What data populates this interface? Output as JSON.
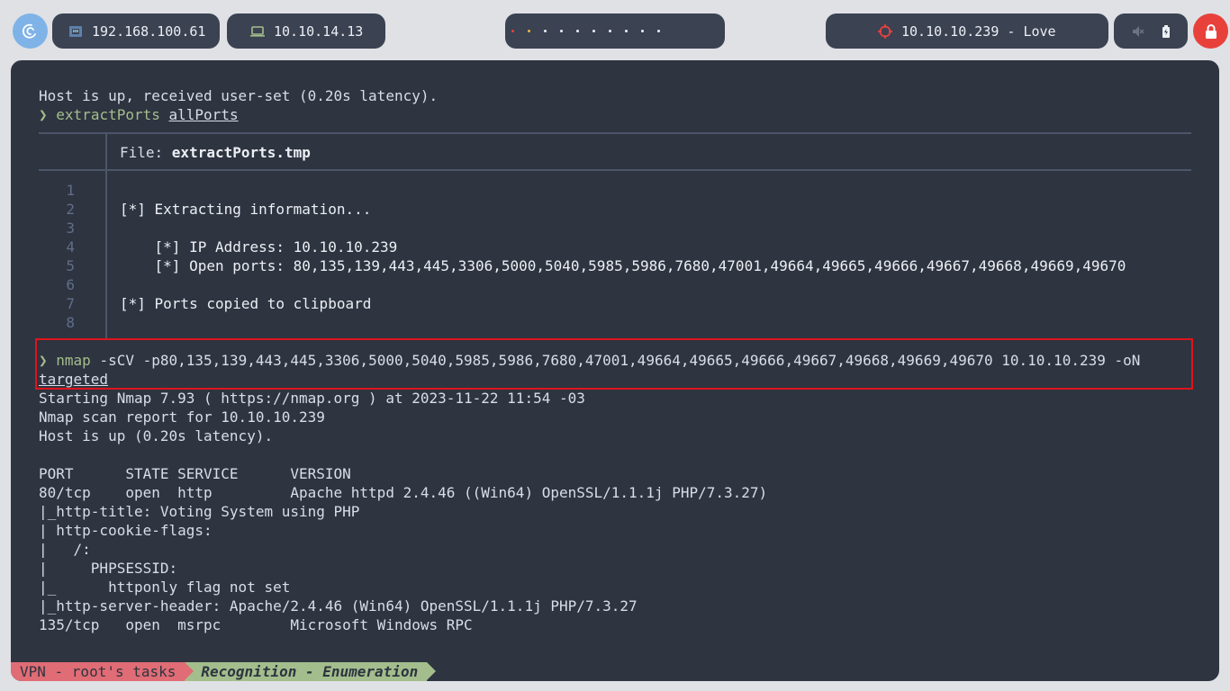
{
  "topbar": {
    "vpn_ip": "192.168.100.61",
    "tun_ip": "10.10.14.13",
    "target": "10.10.10.239 - Love",
    "workspace_dot_colors": [
      "#e8413c",
      "#e8b93c",
      "#eceff4",
      "#eceff4",
      "#eceff4",
      "#eceff4",
      "#eceff4",
      "#eceff4",
      "#eceff4",
      "#eceff4"
    ],
    "icons": [
      "debian-swirl-icon",
      "ethernet-icon",
      "laptop-icon",
      "target-icon",
      "mute-icon",
      "battery-icon",
      "lock-icon"
    ]
  },
  "terminal": {
    "line_host_up": "Host is up, received user-set (0.20s latency).",
    "prompt_symbol": "❯",
    "cmd1_name": "extractPorts",
    "cmd1_arg": "allPorts",
    "file_label": "File: ",
    "file_name": "extractPorts.tmp",
    "file_lines": [
      {
        "n": "1",
        "text": ""
      },
      {
        "n": "2",
        "text": "[*] Extracting information..."
      },
      {
        "n": "3",
        "text": ""
      },
      {
        "n": "4",
        "text": "    [*] IP Address: 10.10.10.239"
      },
      {
        "n": "5",
        "text": "    [*] Open ports: 80,135,139,443,445,3306,5000,5040,5985,5986,7680,47001,49664,49665,49666,49667,49668,49669,49670"
      },
      {
        "n": "6",
        "text": ""
      },
      {
        "n": "7",
        "text": "[*] Ports copied to clipboard"
      },
      {
        "n": "8",
        "text": ""
      }
    ],
    "cmd2_name": "nmap",
    "cmd2_args": " -sCV -p80,135,139,443,445,3306,5000,5040,5985,5986,7680,47001,49664,49665,49666,49667,49668,49669,49670 10.10.10.239 -oN",
    "cmd2_wrap": "targeted",
    "output_lines": [
      "Starting Nmap 7.93 ( https://nmap.org ) at 2023-11-22 11:54 -03",
      "Nmap scan report for 10.10.10.239",
      "Host is up (0.20s latency).",
      "",
      "PORT      STATE SERVICE      VERSION",
      "80/tcp    open  http         Apache httpd 2.4.46 ((Win64) OpenSSL/1.1.1j PHP/7.3.27)",
      "|_http-title: Voting System using PHP",
      "| http-cookie-flags:",
      "|   /:",
      "|     PHPSESSID:",
      "|_      httponly flag not set",
      "|_http-server-header: Apache/2.4.46 (Win64) OpenSSL/1.1.1j PHP/7.3.27",
      "135/tcp   open  msrpc        Microsoft Windows RPC"
    ]
  },
  "statusline": {
    "session": "VPN - root's tasks",
    "window": "Recognition - Enumeration"
  }
}
